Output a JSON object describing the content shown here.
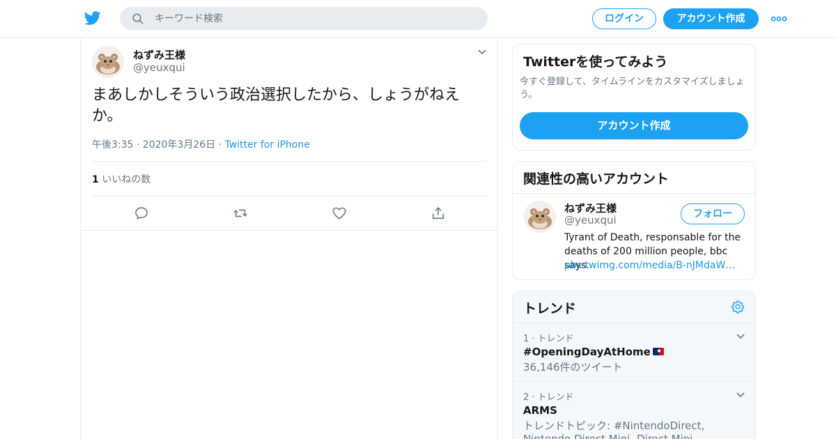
{
  "header": {
    "search_placeholder": "キーワード検索",
    "login_label": "ログイン",
    "signup_label": "アカウント作成"
  },
  "tweet": {
    "display_name": "ねずみ王様",
    "handle": "@yeuxqui",
    "text": "まあしかしそういう政治選択したから、しょうがねえか。",
    "timestamp": "午後3:35 · 2020年3月26日",
    "meta_separator": " · ",
    "source": "Twitter for iPhone",
    "likes_count": "1",
    "likes_label": " いいねの数"
  },
  "try_card": {
    "title": "Twitterを使ってみよう",
    "subtitle": "今すぐ登録して、タイムラインをカスタマイズしましょう。",
    "cta_label": "アカウント作成"
  },
  "related": {
    "title": "関連性の高いアカウント",
    "account": {
      "display_name": "ねずみ王様",
      "handle": "@yeuxqui",
      "follow_label": "フォロー",
      "bio": "Tyrant of Death, responsable for the deaths of 200 million people, bbc says.",
      "bio_link": "pbs.twimg.com/media/B-nJMdaW…"
    }
  },
  "trends": {
    "title": "トレンド",
    "items": [
      {
        "rank": "1 · トレンド",
        "name": "#OpeningDayAtHome",
        "detail": "36,146件のツイート"
      },
      {
        "rank": "2 · トレンド",
        "name": "ARMS",
        "detail": "トレンドトピック: #NintendoDirect, Nintendo Direct Mini, Direct Mini"
      }
    ]
  },
  "colors": {
    "accent": "#1da1f2",
    "link": "#1b95e0",
    "text_primary": "#14171a",
    "text_secondary": "#657786",
    "border": "#e6ecf0",
    "panel_bg": "#f5f8fa"
  },
  "icons": [
    "twitter-bird-icon",
    "search-icon",
    "more-icon",
    "chevron-down-icon",
    "reply-icon",
    "retweet-icon",
    "like-icon",
    "share-icon",
    "gear-icon",
    "mlb-logo-icon"
  ]
}
